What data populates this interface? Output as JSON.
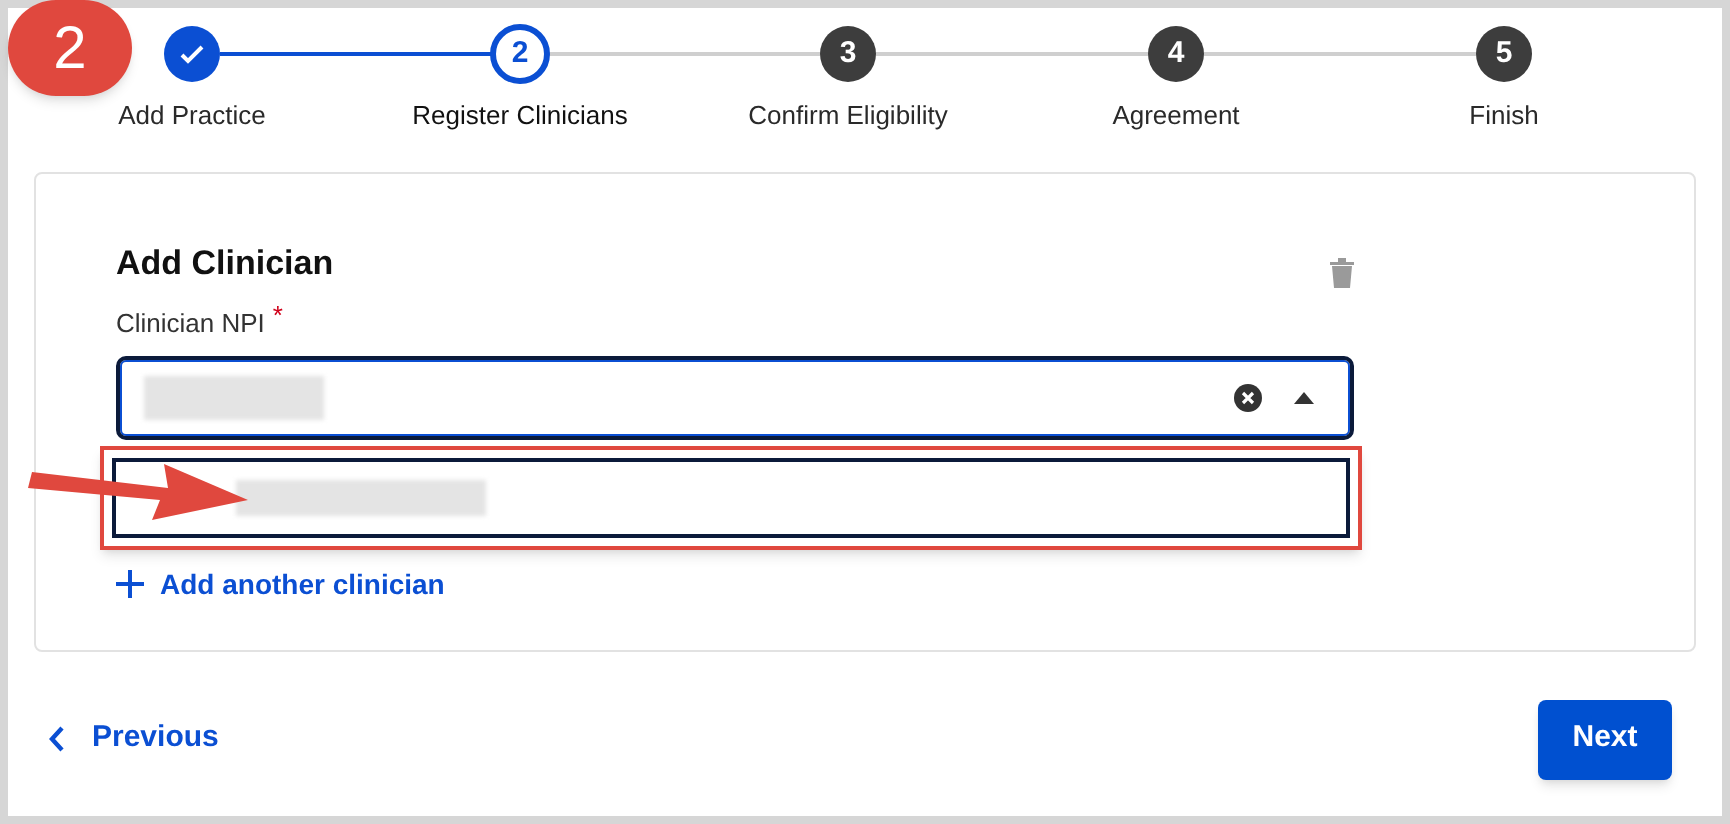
{
  "annotation": {
    "badge": "2"
  },
  "steps": [
    {
      "label": "Add Practice",
      "done": true,
      "selected": false
    },
    {
      "number": "2",
      "label": "Register Clinicians",
      "done": false,
      "selected": true
    },
    {
      "number": "3",
      "label": "Confirm Eligibility",
      "done": false,
      "selected": false
    },
    {
      "number": "4",
      "label": "Agreement",
      "done": false,
      "selected": false
    },
    {
      "number": "5",
      "label": "Finish",
      "done": false,
      "selected": false
    }
  ],
  "form": {
    "title": "Add Clinician",
    "field_label": "Clinician NPI",
    "required_mark": "*",
    "dropdown_open": true,
    "add_link": "Add another clinician"
  },
  "footer": {
    "previous": "Previous",
    "next": "Next"
  }
}
